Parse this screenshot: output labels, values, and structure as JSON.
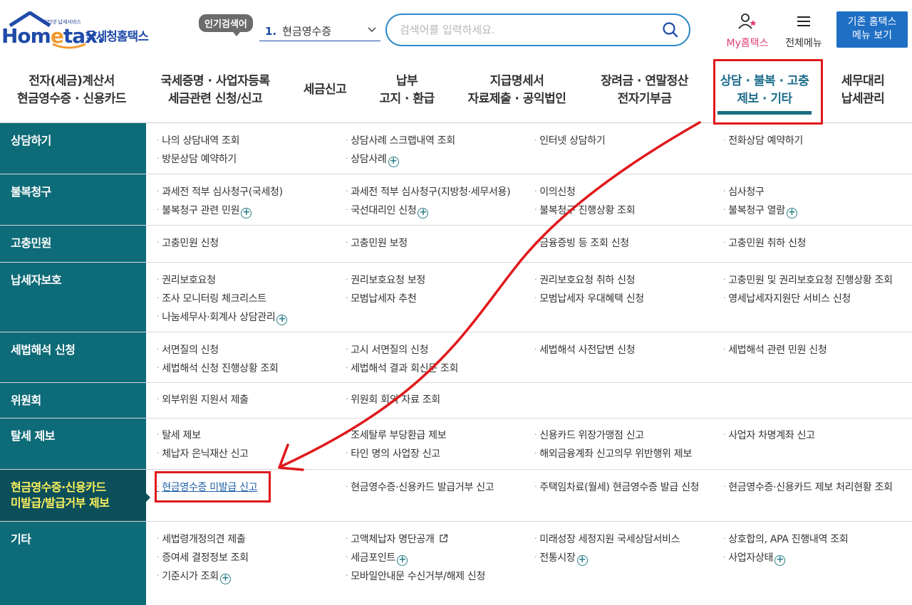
{
  "header": {
    "logo_small": "인터넷 납세서비스",
    "logo_word_a": "Hom",
    "logo_word_e": "e",
    "logo_word_b": "tax.",
    "logo_kor": "국세청홈택스",
    "popular_badge": "인기검색어",
    "popular_num": "1.",
    "popular_term": "현금영수증",
    "search_placeholder": "검색어를 입력하세요.",
    "my_hometax": "My홈택스",
    "all_menu": "전체메뉴",
    "old_site_1": "기존 홈택스",
    "old_site_2": "메뉴 보기"
  },
  "gnb": [
    {
      "l1": "전자(세금)계산서",
      "l2": "현금영수증 · 신용카드"
    },
    {
      "l1": "국세증명 · 사업자등록",
      "l2": "세금관련 신청/신고"
    },
    {
      "l1": "세금신고",
      "l2": ""
    },
    {
      "l1": "납부",
      "l2": "고지 · 환급"
    },
    {
      "l1": "지급명세서",
      "l2": "자료제출 · 공익법인"
    },
    {
      "l1": "장려금 · 연말정산",
      "l2": "전자기부금"
    },
    {
      "l1": "상담 · 불복 · 고충",
      "l2": "제보 · 기타"
    },
    {
      "l1": "세무대리",
      "l2": "납세관리"
    }
  ],
  "menu": [
    {
      "cat": "상담하기",
      "links": [
        "나의 상담내역 조회",
        "상담사례 스크랩내역 조회",
        "인터넷 상담하기",
        "전화상담 예약하기",
        "방문상담 예약하기",
        "상담사례"
      ]
    },
    {
      "cat": "불복청구",
      "links": [
        "과세전 적부 심사청구(국세청)",
        "과세전 적부 심사청구(지방청·세무서용)",
        "이의신청",
        "심사청구",
        "불복청구 관련 민원",
        "국선대리인 신청",
        "불복청구 진행상황 조회",
        "불복청구 열람"
      ]
    },
    {
      "cat": "고충민원",
      "links": [
        "고충민원 신청",
        "고충민원 보정",
        "금융증빙 등 조회 신청",
        "고충민원 취하 신청"
      ]
    },
    {
      "cat": "납세자보호",
      "links": [
        "권리보호요청",
        "권리보호요청 보정",
        "권리보호요청 취하 신청",
        "고충민원 및 권리보호요청 진행상황 조회",
        "조사 모니터링 체크리스트",
        "모범납세자 추천",
        "모범납세자 우대혜택 신청",
        "영세납세자지원단 서비스 신청",
        "나눔세무사·회계사 상담관리"
      ]
    },
    {
      "cat": "세법해석 신청",
      "links": [
        "서면질의 신청",
        "고시 서면질의 신청",
        "세법해석 사전답변 신청",
        "세법해석 관련 민원 신청",
        "세법해석 신청 진행상황 조회",
        "세법해석 결과 회신문 조회"
      ]
    },
    {
      "cat": "위원회",
      "links": [
        "외부위원 지원서 제출",
        "위원회 회의 자료 조회"
      ]
    },
    {
      "cat": "탈세 제보",
      "links": [
        "탈세 제보",
        "조세탈루 부당환급 제보",
        "신용카드 위장가맹점 신고",
        "사업자 차명계좌 신고",
        "체납자 은닉재산 신고",
        "타인 명의 사업장 신고",
        "해외금융계좌 신고의무 위반행위 제보"
      ]
    },
    {
      "cat1": "현금영수증·신용카드",
      "cat2": "미발급/발급거부 제보",
      "links": [
        "현금영수증 미발급 신고",
        "현금영수증·신용카드 발급거부 신고",
        "주택임차료(월세) 현금영수증 발급 신청",
        "현금영수증·신용카드 제보 처리현황 조회"
      ]
    },
    {
      "cat": "기타",
      "links": [
        "세법령개정의견 제출",
        "고액체납자 명단공개",
        "미래성장 세정지원 국세상담서비스",
        "상호합의, APA 진행내역 조회",
        "증여세 결정정보 조회",
        "세금포인트",
        "전통시장",
        "사업자상태",
        "기준시가 조회",
        "모바일안내문 수신거부/해제 신청"
      ]
    }
  ],
  "colors": {
    "category_bg": "#0e6b78",
    "highlight_bg": "#0c4f5b",
    "highlight_text": "#fff35c",
    "annotation_red": "#e0181c",
    "accent_blue": "#1f6fc5"
  }
}
